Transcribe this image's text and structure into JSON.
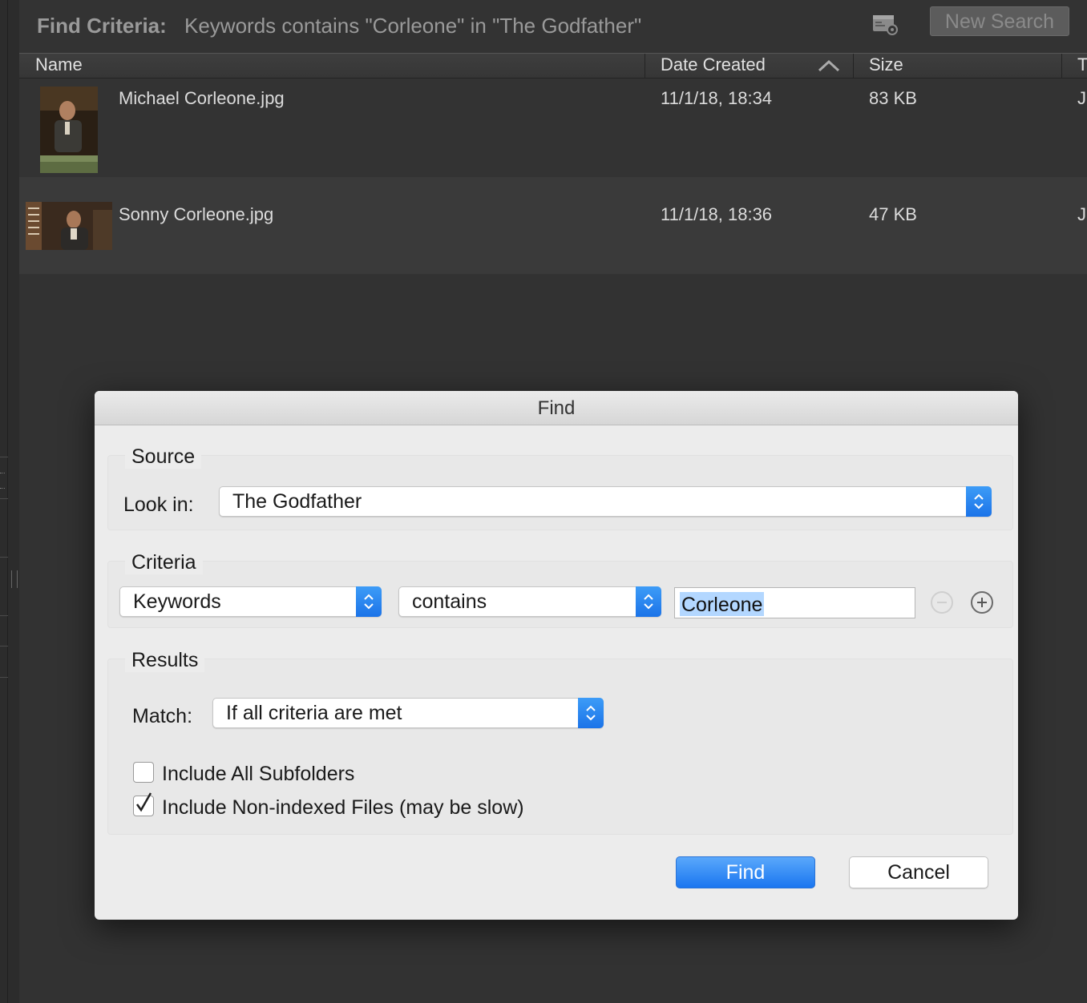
{
  "search_bar": {
    "criteria_label": "Find Criteria:",
    "criteria_text": "Keywords contains \"Corleone\" in \"The Godfather\"",
    "new_search_label": "New Search"
  },
  "table": {
    "columns": [
      "Name",
      "Date Created",
      "Size",
      "T"
    ],
    "sort_column": "Date Created",
    "sort_direction": "ascending",
    "rows": [
      {
        "name": "Michael Corleone.jpg",
        "date": "11/1/18, 18:34",
        "size": "83 KB",
        "type": "J"
      },
      {
        "name": "Sonny Corleone.jpg",
        "date": "11/1/18, 18:36",
        "size": "47 KB",
        "type": "J"
      }
    ]
  },
  "dialog": {
    "title": "Find",
    "source": {
      "title": "Source",
      "look_in_label": "Look in:",
      "look_in_value": "The Godfather"
    },
    "criteria": {
      "title": "Criteria",
      "field": "Keywords",
      "operator": "contains",
      "value": "Corleone"
    },
    "results": {
      "title": "Results",
      "match_label": "Match:",
      "match_value": "If all criteria are met",
      "include_subfolders_label": "Include All Subfolders",
      "include_subfolders_checked": false,
      "include_nonindexed_label": "Include Non-indexed Files (may be slow)",
      "include_nonindexed_checked": true
    },
    "find_label": "Find",
    "cancel_label": "Cancel"
  },
  "colors": {
    "accent": "#1a76f0",
    "background": "#323232",
    "dialog_bg": "#ececec",
    "selection": "#b3d7ff"
  }
}
